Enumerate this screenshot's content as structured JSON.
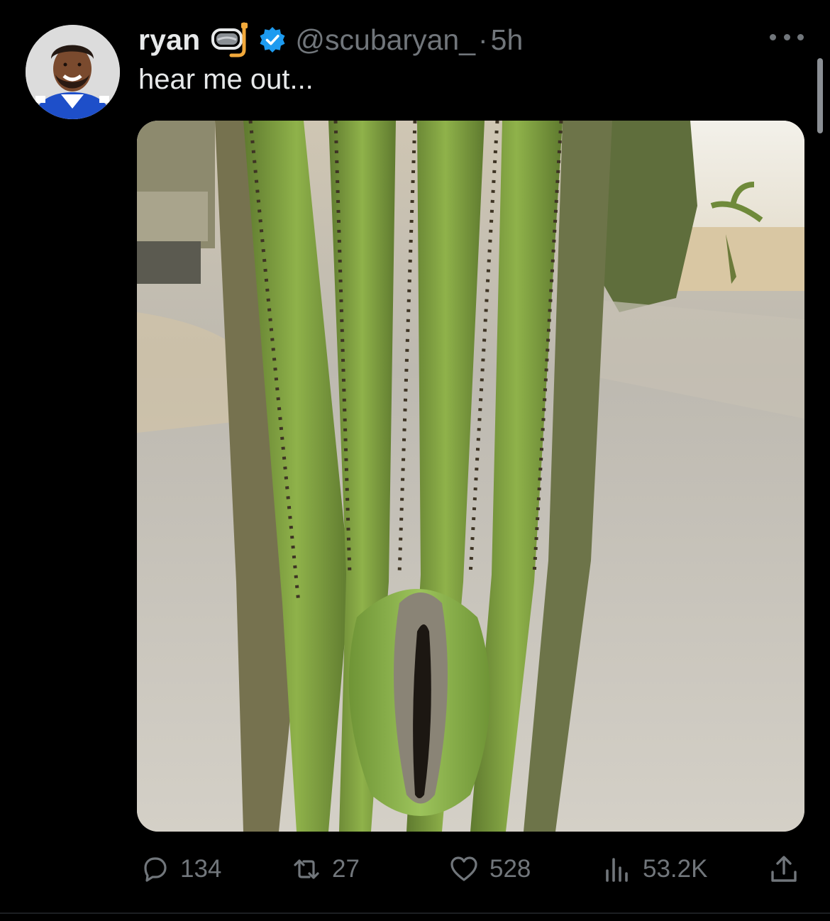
{
  "author": {
    "display_name": "ryan",
    "name_emoji": "snorkel-mask-emoji",
    "verified_badge": "verified-badge-icon",
    "handle": "@scubaryan_",
    "separator": "·",
    "timestamp": "5h"
  },
  "tweet": {
    "text": "hear me out..."
  },
  "actions": {
    "replies": "134",
    "retweets": "27",
    "likes": "528",
    "views": "53.2K"
  },
  "colors": {
    "background": "#000000",
    "primary_text": "#e7e9ea",
    "secondary_text": "#71767b",
    "verified_blue": "#1d9bf0"
  }
}
